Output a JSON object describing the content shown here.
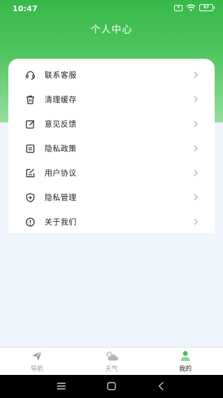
{
  "status_bar": {
    "time": "10:47",
    "battery": "67"
  },
  "header": {
    "title": "个人中心"
  },
  "menu": {
    "items": [
      {
        "label": "联系客服",
        "icon": "headset-icon"
      },
      {
        "label": "清理缓存",
        "icon": "trash-icon"
      },
      {
        "label": "意见反馈",
        "icon": "edit-icon"
      },
      {
        "label": "隐私政策",
        "icon": "document-icon"
      },
      {
        "label": "用户协议",
        "icon": "agreement-icon"
      },
      {
        "label": "隐私管理",
        "icon": "shield-plus-icon"
      },
      {
        "label": "关于我们",
        "icon": "info-icon"
      }
    ]
  },
  "tabs": [
    {
      "label": "导航",
      "icon": "paper-plane-icon",
      "active": false
    },
    {
      "label": "天气",
      "icon": "weather-cloud-icon",
      "active": false
    },
    {
      "label": "我的",
      "icon": "user-icon",
      "active": true
    }
  ],
  "colors": {
    "brand_green": "#36b94a",
    "page_background": "#eef5fd",
    "active_tab_icon": "#4cc25a"
  }
}
